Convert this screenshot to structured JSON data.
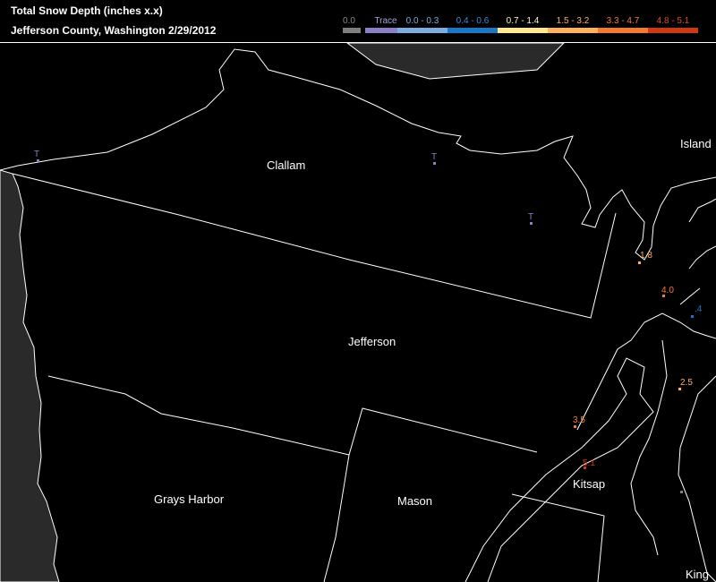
{
  "header": {
    "title": "Total Snow Depth (inches  x.x)",
    "subtitle": "Jefferson County, Washington  2/29/2012"
  },
  "legend": [
    {
      "label": "0.0",
      "color": "#7f7f7f"
    },
    {
      "label": "Trace",
      "color": "#8a80c8"
    },
    {
      "label": "0.0 - 0.3",
      "color": "#78aee0"
    },
    {
      "label": "0.4 - 0.6",
      "color": "#1b78c8"
    },
    {
      "label": "0.7 - 1.4",
      "color": "#ffe890"
    },
    {
      "label": "1.5 - 3.2",
      "color": "#ffb060"
    },
    {
      "label": "3.3 - 4.7",
      "color": "#f47a32"
    },
    {
      "label": "4.8 - 5.1",
      "color": "#d03810"
    }
  ],
  "counties": {
    "clallam": "Clallam",
    "jefferson": "Jefferson",
    "grays_harbor": "Grays Harbor",
    "mason": "Mason",
    "kitsap": "Kitsap",
    "island": "Island",
    "king": "King"
  },
  "observations": {
    "t1": "T",
    "t2": "T",
    "t3": "T",
    "o18": "1.8",
    "o40": "4.0",
    "o4": ".4",
    "o25": "2.5",
    "o35": "3.5",
    "o51": "5.1"
  },
  "colors": {
    "trace": "#8a80c8",
    "range_04_06": "#1b78c8",
    "range_15_32": "#ffb060",
    "range_33_47": "#f47a32",
    "range_48_51": "#d03810",
    "land_outside": "#2a2a2a"
  }
}
